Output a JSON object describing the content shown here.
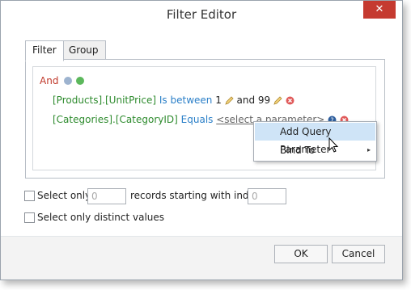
{
  "window": {
    "title": "Filter Editor",
    "close_glyph": "✕"
  },
  "tabs": [
    {
      "label": "Filter",
      "active": true
    },
    {
      "label": "Group Filter",
      "active": false
    }
  ],
  "filter": {
    "group_operator": "And",
    "conditions": [
      {
        "field": "[Products].[UnitPrice]",
        "operator": "Is between",
        "value1": "1",
        "connector": "and",
        "value2": "99"
      },
      {
        "field": "[Categories].[CategoryID]",
        "operator": "Equals",
        "value_placeholder": "<select a parameter>"
      }
    ]
  },
  "context_menu": {
    "items": [
      {
        "label": "Add Query Parameter",
        "highlighted": true,
        "has_submenu": false
      },
      {
        "label": "Bind To",
        "highlighted": false,
        "has_submenu": true
      }
    ],
    "submenu_arrow": "▸"
  },
  "options": {
    "select_only_label": "Select only",
    "select_only_value": "0",
    "records_label": "records starting with index",
    "start_index_value": "0",
    "distinct_label": "Select only distinct values"
  },
  "buttons": {
    "ok": "OK",
    "cancel": "Cancel"
  },
  "colors": {
    "close_button": "#c53a30",
    "field": "#2e8b2e",
    "operator": "#2a7fc8",
    "group_operator": "#c0392b",
    "menu_highlight": "#cfe4f7"
  },
  "icons": [
    "close-icon",
    "group-options-icon",
    "add-condition-icon",
    "edit-pencil-icon",
    "remove-condition-icon",
    "help-icon",
    "submenu-arrow-icon",
    "mouse-cursor-icon"
  ]
}
